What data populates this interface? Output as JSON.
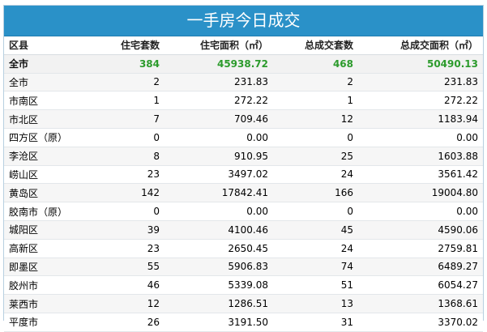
{
  "title": "一手房今日成交",
  "columns": [
    "区县",
    "住宅套数",
    "住宅面积（㎡）",
    "总成交套数",
    "总成交面积（㎡）"
  ],
  "total": {
    "name": "全市",
    "res_units": "384",
    "res_area": "45938.72",
    "total_units": "468",
    "total_area": "50490.13"
  },
  "rows": [
    {
      "name": "全市",
      "res_units": "2",
      "res_area": "231.83",
      "total_units": "2",
      "total_area": "231.83"
    },
    {
      "name": "市南区",
      "res_units": "1",
      "res_area": "272.22",
      "total_units": "1",
      "total_area": "272.22"
    },
    {
      "name": "市北区",
      "res_units": "7",
      "res_area": "709.46",
      "total_units": "12",
      "total_area": "1183.94"
    },
    {
      "name": "四方区（原）",
      "res_units": "0",
      "res_area": "0.00",
      "total_units": "0",
      "total_area": "0.00"
    },
    {
      "name": "李沧区",
      "res_units": "8",
      "res_area": "910.95",
      "total_units": "25",
      "total_area": "1603.88"
    },
    {
      "name": "崂山区",
      "res_units": "23",
      "res_area": "3497.02",
      "total_units": "24",
      "total_area": "3561.42"
    },
    {
      "name": "黄岛区",
      "res_units": "142",
      "res_area": "17842.41",
      "total_units": "166",
      "total_area": "19004.80"
    },
    {
      "name": "胶南市（原）",
      "res_units": "0",
      "res_area": "0.00",
      "total_units": "0",
      "total_area": "0.00"
    },
    {
      "name": "城阳区",
      "res_units": "39",
      "res_area": "4100.46",
      "total_units": "45",
      "total_area": "4590.06"
    },
    {
      "name": "高新区",
      "res_units": "23",
      "res_area": "2650.45",
      "total_units": "24",
      "total_area": "2759.81"
    },
    {
      "name": "即墨区",
      "res_units": "55",
      "res_area": "5906.83",
      "total_units": "74",
      "total_area": "6489.27"
    },
    {
      "name": "胶州市",
      "res_units": "46",
      "res_area": "5339.08",
      "total_units": "51",
      "total_area": "6054.27"
    },
    {
      "name": "莱西市",
      "res_units": "12",
      "res_area": "1286.51",
      "total_units": "13",
      "total_area": "1368.61"
    },
    {
      "name": "平度市",
      "res_units": "26",
      "res_area": "3191.50",
      "total_units": "31",
      "total_area": "3370.02"
    }
  ],
  "colors": {
    "title_bg": "#2a91c8",
    "total_green": "#2c9b2c",
    "row_stripe": "#f6f6f6"
  }
}
